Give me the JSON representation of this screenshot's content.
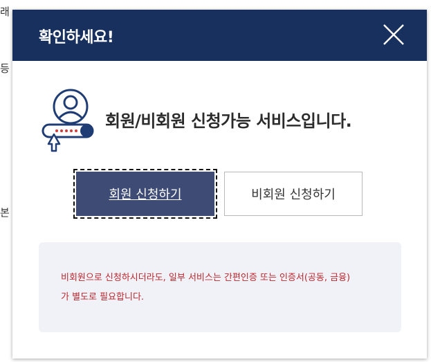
{
  "background": {
    "fragments": [
      "래",
      "등",
      "본"
    ]
  },
  "modal": {
    "title": "확인하세요!",
    "close_icon": "close-icon",
    "headline": "회원/비회원 신청가능 서비스입니다.",
    "headline_icon": "user-login-icon",
    "buttons": {
      "member": "회원 신청하기",
      "guest": "비회원 신청하기"
    },
    "notice": {
      "line1": "비회원으로 신청하시더라도, 일부 서비스는 간편인증 또는 인증서(공동, 금융)",
      "line2": "가 별도로 필요합니다."
    }
  },
  "colors": {
    "header": "#17305e",
    "member_button": "#3d4b75",
    "notice_text": "#c0262d",
    "notice_bg": "#f0f2f7"
  }
}
